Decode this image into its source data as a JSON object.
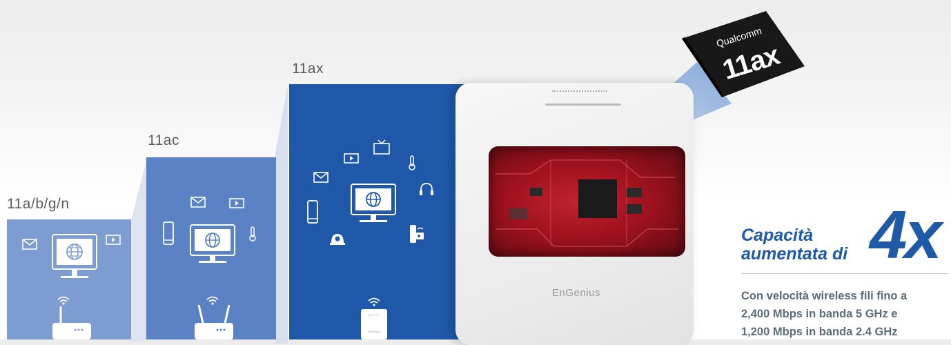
{
  "generations": [
    {
      "label": "11a/b/g/n",
      "color": "#7b9bd0"
    },
    {
      "label": "11ac",
      "color": "#5b82c4"
    },
    {
      "label": "11ax",
      "color": "#1f58a8"
    }
  ],
  "access_point": {
    "brand": "EnGenius",
    "mini_brand": "EnGenius"
  },
  "chip": {
    "maker": "Qualcomm",
    "model": "11ax"
  },
  "capacity": {
    "line1": "Capacità",
    "line2": "aumentata di",
    "multiplier": "4x"
  },
  "description": {
    "line1": "Con velocità wireless fili fino a",
    "line2": "2,400 Mbps in banda 5 GHz e",
    "line3": "1,200 Mbps in banda 2.4 GHz"
  },
  "icons": [
    "mail-icon",
    "play-icon",
    "monitor-globe-icon",
    "router-icon",
    "smartphone-icon",
    "thermometer-icon",
    "tv-icon",
    "headphones-icon",
    "camera-icon",
    "smart-lock-icon",
    "wifi-icon"
  ]
}
